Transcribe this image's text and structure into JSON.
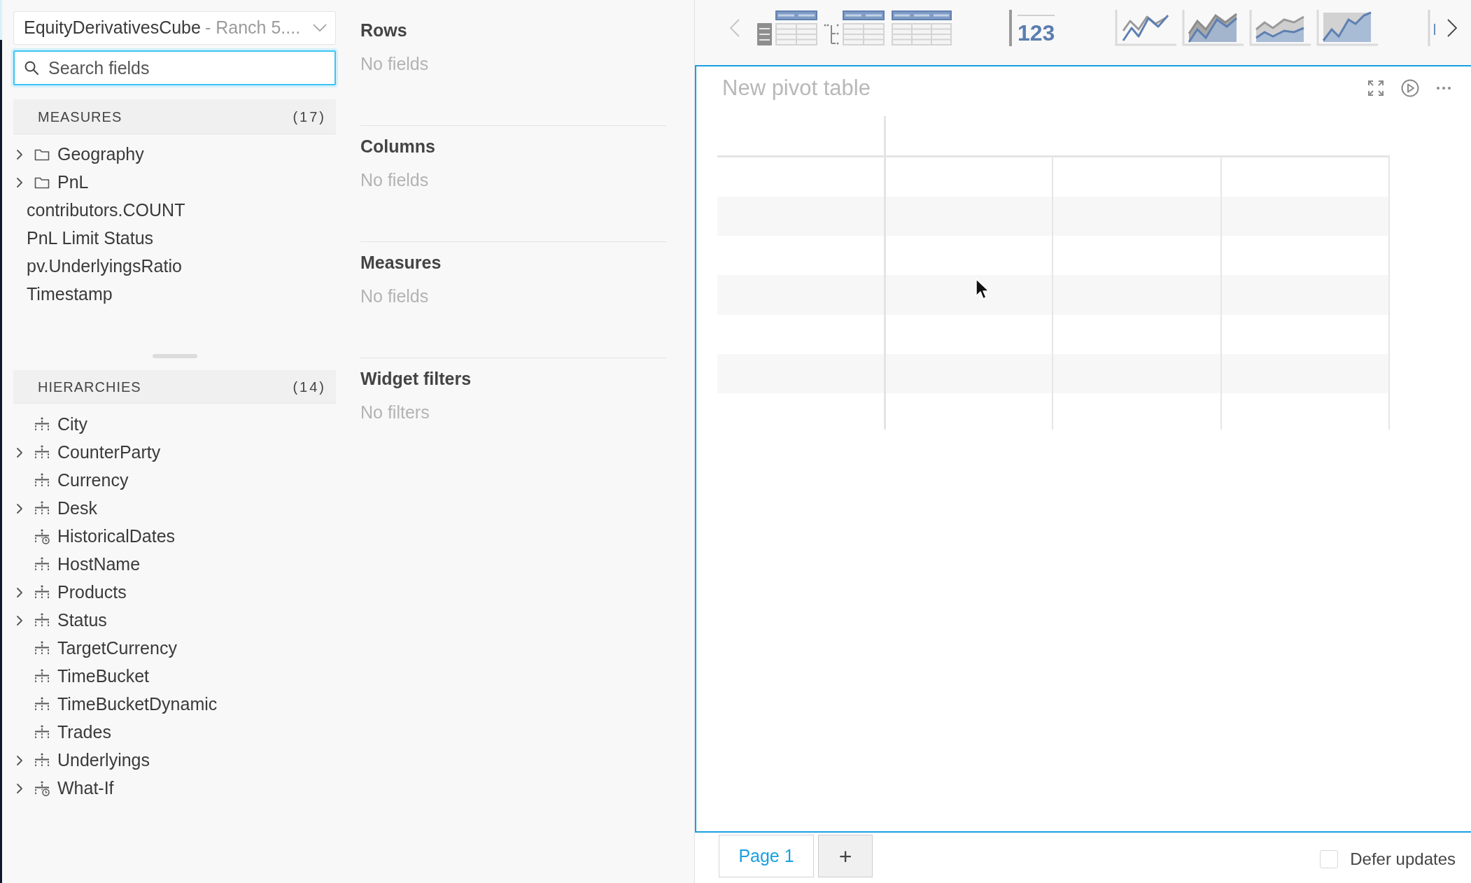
{
  "data_source": {
    "cube": "EquityDerivativesCube",
    "server": "- Ranch 5...."
  },
  "search": {
    "placeholder": "Search fields",
    "focused": true
  },
  "measures": {
    "title": "MEASURES",
    "count": "(17)",
    "items": [
      {
        "label": "Geography",
        "kind": "folder",
        "expandable": true
      },
      {
        "label": "PnL",
        "kind": "folder",
        "expandable": true
      },
      {
        "label": "contributors.COUNT",
        "kind": "measure",
        "expandable": false
      },
      {
        "label": "PnL Limit Status",
        "kind": "measure",
        "expandable": false
      },
      {
        "label": "pv.UnderlyingsRatio",
        "kind": "measure",
        "expandable": false
      },
      {
        "label": "Timestamp",
        "kind": "measure",
        "expandable": false
      }
    ]
  },
  "hierarchies": {
    "title": "HIERARCHIES",
    "count": "(14)",
    "items": [
      {
        "label": "City",
        "kind": "hierarchy",
        "expandable": false
      },
      {
        "label": "CounterParty",
        "kind": "hierarchy",
        "expandable": true
      },
      {
        "label": "Currency",
        "kind": "hierarchy",
        "expandable": false
      },
      {
        "label": "Desk",
        "kind": "hierarchy",
        "expandable": true
      },
      {
        "label": "HistoricalDates",
        "kind": "time_hierarchy",
        "expandable": false
      },
      {
        "label": "HostName",
        "kind": "hierarchy",
        "expandable": false
      },
      {
        "label": "Products",
        "kind": "hierarchy",
        "expandable": true
      },
      {
        "label": "Status",
        "kind": "hierarchy",
        "expandable": true
      },
      {
        "label": "TargetCurrency",
        "kind": "hierarchy",
        "expandable": false
      },
      {
        "label": "TimeBucket",
        "kind": "hierarchy",
        "expandable": false
      },
      {
        "label": "TimeBucketDynamic",
        "kind": "hierarchy",
        "expandable": false
      },
      {
        "label": "Trades",
        "kind": "hierarchy",
        "expandable": false
      },
      {
        "label": "Underlyings",
        "kind": "hierarchy",
        "expandable": true
      },
      {
        "label": "What-If",
        "kind": "time_hierarchy",
        "expandable": true
      }
    ]
  },
  "wizard_sections": [
    {
      "title": "Rows",
      "empty_text": "No fields"
    },
    {
      "title": "Columns",
      "empty_text": "No fields"
    },
    {
      "title": "Measures",
      "empty_text": "No fields"
    },
    {
      "title": "Widget filters",
      "empty_text": "No filters"
    }
  ],
  "widget_palette": {
    "previous": {
      "disabled": true
    },
    "next": {
      "disabled": false
    },
    "items": [
      {
        "kind": "pivot_table"
      },
      {
        "kind": "tree_table"
      },
      {
        "kind": "table"
      },
      {
        "kind": "kpi",
        "text": "123"
      },
      {
        "kind": "line_chart"
      },
      {
        "kind": "area_chart"
      },
      {
        "kind": "stacked_area_chart"
      },
      {
        "kind": "percent_area_chart"
      },
      {
        "kind": "clipped"
      }
    ]
  },
  "widget": {
    "title": "New pivot table",
    "focused": true
  },
  "pages": {
    "tabs": [
      {
        "label": "Page 1",
        "selected": true
      }
    ],
    "add": "+"
  },
  "defer_updates": {
    "label": "Defer updates",
    "checked": false
  }
}
